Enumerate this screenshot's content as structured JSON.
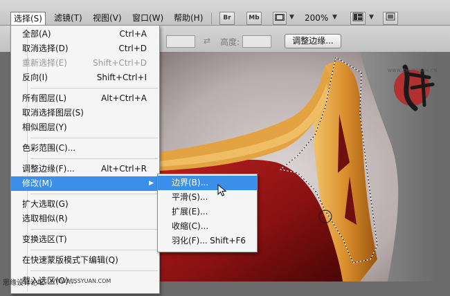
{
  "menubar": {
    "items": [
      {
        "label": "选择(S)",
        "active": true
      },
      {
        "label": "滤镜(T)"
      },
      {
        "label": "视图(V)"
      },
      {
        "label": "窗口(W)"
      },
      {
        "label": "帮助(H)"
      }
    ],
    "br_label": "Br",
    "mb_label": "Mb",
    "zoom": "200%"
  },
  "options": {
    "height_label": "高度:",
    "refine_edge": "调整边缘..."
  },
  "select_menu": {
    "items": [
      {
        "label": "全部(A)",
        "shortcut": "Ctrl+A"
      },
      {
        "label": "取消选择(D)",
        "shortcut": "Ctrl+D"
      },
      {
        "label": "重新选择(E)",
        "shortcut": "Shift+Ctrl+D",
        "disabled": true
      },
      {
        "label": "反向(I)",
        "shortcut": "Shift+Ctrl+I"
      },
      {
        "label": "所有图层(L)",
        "shortcut": "Alt+Ctrl+A"
      },
      {
        "label": "取消选择图层(S)",
        "shortcut": ""
      },
      {
        "label": "相似图层(Y)",
        "shortcut": ""
      },
      {
        "label": "色彩范围(C)...",
        "shortcut": ""
      },
      {
        "label": "调整边缘(F)...",
        "shortcut": "Alt+Ctrl+R"
      },
      {
        "label": "修改(M)",
        "shortcut": ""
      },
      {
        "label": "扩大选取(G)",
        "shortcut": ""
      },
      {
        "label": "选取相似(R)",
        "shortcut": ""
      },
      {
        "label": "变换选区(T)",
        "shortcut": ""
      },
      {
        "label": "在快速蒙版模式下编辑(Q)",
        "shortcut": ""
      },
      {
        "label": "载入选区(O)...",
        "shortcut": ""
      }
    ]
  },
  "modify_menu": {
    "items": [
      {
        "label": "边界(B)...",
        "shortcut": ""
      },
      {
        "label": "平滑(S)...",
        "shortcut": ""
      },
      {
        "label": "扩展(E)...",
        "shortcut": ""
      },
      {
        "label": "收缩(C)...",
        "shortcut": ""
      },
      {
        "label": "羽化(F)...",
        "shortcut": "Shift+F6"
      }
    ]
  },
  "watermark": {
    "site_name": "思缘设计论坛",
    "url": "WWW.MISSYUAN.COM",
    "seal_url": "WWW.ZHUOSHEN.CN"
  },
  "colors": {
    "highlight": "#3b8fe8",
    "gown_red": "#8e1414",
    "gold_trim": "#e0a040",
    "skin": "#c8bcbc"
  }
}
